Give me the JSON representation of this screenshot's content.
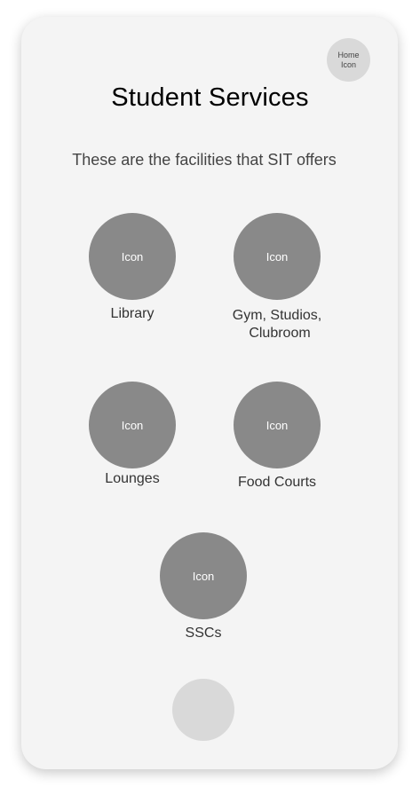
{
  "header": {
    "home_icon_line1": "Home",
    "home_icon_line2": "Icon",
    "title": "Student Services",
    "subtitle": "These are the facilities that SIT offers"
  },
  "facilities": [
    {
      "icon_text": "Icon",
      "label": "Library"
    },
    {
      "icon_text": "Icon",
      "label_line1": "Gym, Studios,",
      "label_line2": "Clubroom"
    },
    {
      "icon_text": "Icon",
      "label": "Lounges"
    },
    {
      "icon_text": "Icon",
      "label": "Food Courts"
    },
    {
      "icon_text": "Icon",
      "label": "SSCs"
    }
  ],
  "colors": {
    "phone_bg": "#f4f4f4",
    "icon_circle": "#898989",
    "button_circle": "#d9d9d9"
  }
}
